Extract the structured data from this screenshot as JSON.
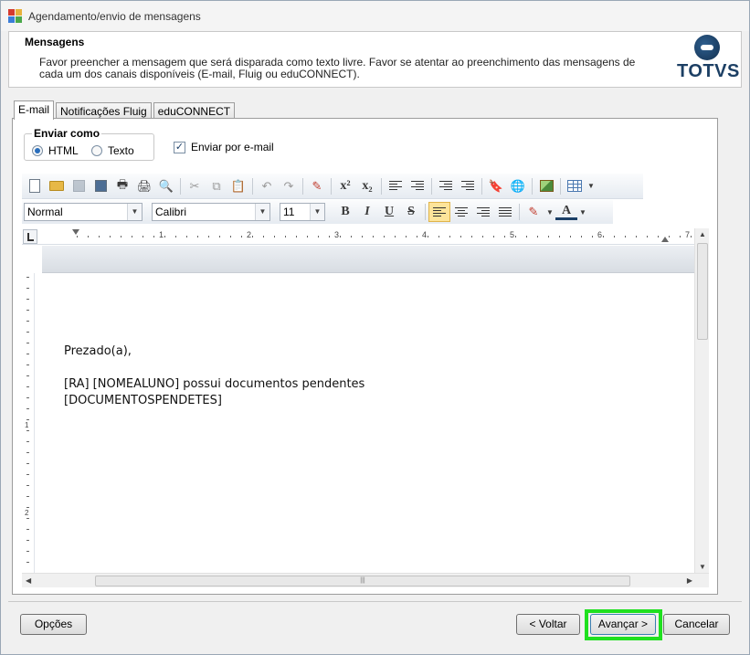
{
  "window": {
    "title": "Agendamento/envio de mensagens",
    "icon": "app-window-icon"
  },
  "header": {
    "title": "Mensagens",
    "description": "Favor preencher a mensagem que será disparada como texto livre. Favor se atentar ao preenchimento das mensagens de cada um dos canais disponíveis (E-mail, Fluig ou eduCONNECT).",
    "logo_text": "TOTVS",
    "logo_color": "#1c3f64"
  },
  "tabs": [
    {
      "label": "E-mail",
      "active": true
    },
    {
      "label": "Notificações Fluig",
      "active": false
    },
    {
      "label": "eduCONNECT",
      "active": false
    }
  ],
  "send_as": {
    "title": "Enviar como",
    "options": [
      {
        "label": "HTML",
        "selected": true
      },
      {
        "label": "Texto",
        "selected": false
      }
    ]
  },
  "send_email": {
    "label": "Enviar por e-mail",
    "checked": true
  },
  "format": {
    "style": "Normal",
    "font": "Calibri",
    "size": "11"
  },
  "toolbar": {
    "superscript": "x²",
    "subscript": "x₂",
    "bold": "B",
    "italic": "I",
    "underline": "U",
    "strike": "S",
    "font_color": "A"
  },
  "ruler": {
    "numbers": [
      "1",
      "2",
      "3",
      "4",
      "5",
      "6",
      "7"
    ],
    "vertical_numbers": [
      "1",
      "2"
    ]
  },
  "editor": {
    "lines": [
      "Prezado(a),",
      "",
      "[RA] [NOMEALUNO] possui documentos pendentes",
      "[DOCUMENTOSPENDETES]"
    ]
  },
  "buttons": {
    "options": "Opções",
    "back": "< Voltar",
    "next": "Avançar >",
    "cancel": "Cancelar"
  },
  "colors": {
    "highlight": "#1fe01f",
    "accent": "#2a6ebc"
  }
}
